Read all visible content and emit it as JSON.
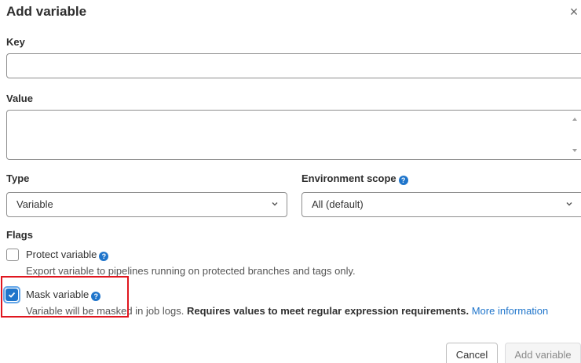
{
  "dialog": {
    "title": "Add variable",
    "close_glyph": "×",
    "close_icon": "close-icon"
  },
  "key": {
    "label": "Key",
    "value": "",
    "placeholder": ""
  },
  "value_field": {
    "label": "Value",
    "value": ""
  },
  "type": {
    "label": "Type",
    "selected": "Variable",
    "icon": "chevron-down-icon"
  },
  "environment_scope": {
    "label": "Environment scope",
    "selected": "All (default)",
    "help_icon": "question-icon",
    "icon": "chevron-down-icon"
  },
  "flags": {
    "label": "Flags",
    "protect": {
      "label": "Protect variable",
      "checked": false,
      "help_text": "Export variable to pipelines running on protected branches and tags only."
    },
    "mask": {
      "label": "Mask variable",
      "checked": true,
      "help_text_start": "Variable will be masked in job logs.",
      "help_text_bold": "Requires values to meet regular expression requirements.",
      "help_link": "More information"
    },
    "help_glyph": "?"
  },
  "buttons": {
    "cancel": "Cancel",
    "add": "Add variable"
  },
  "colors": {
    "accent": "#1f75cb",
    "highlight": "#e0161f"
  }
}
